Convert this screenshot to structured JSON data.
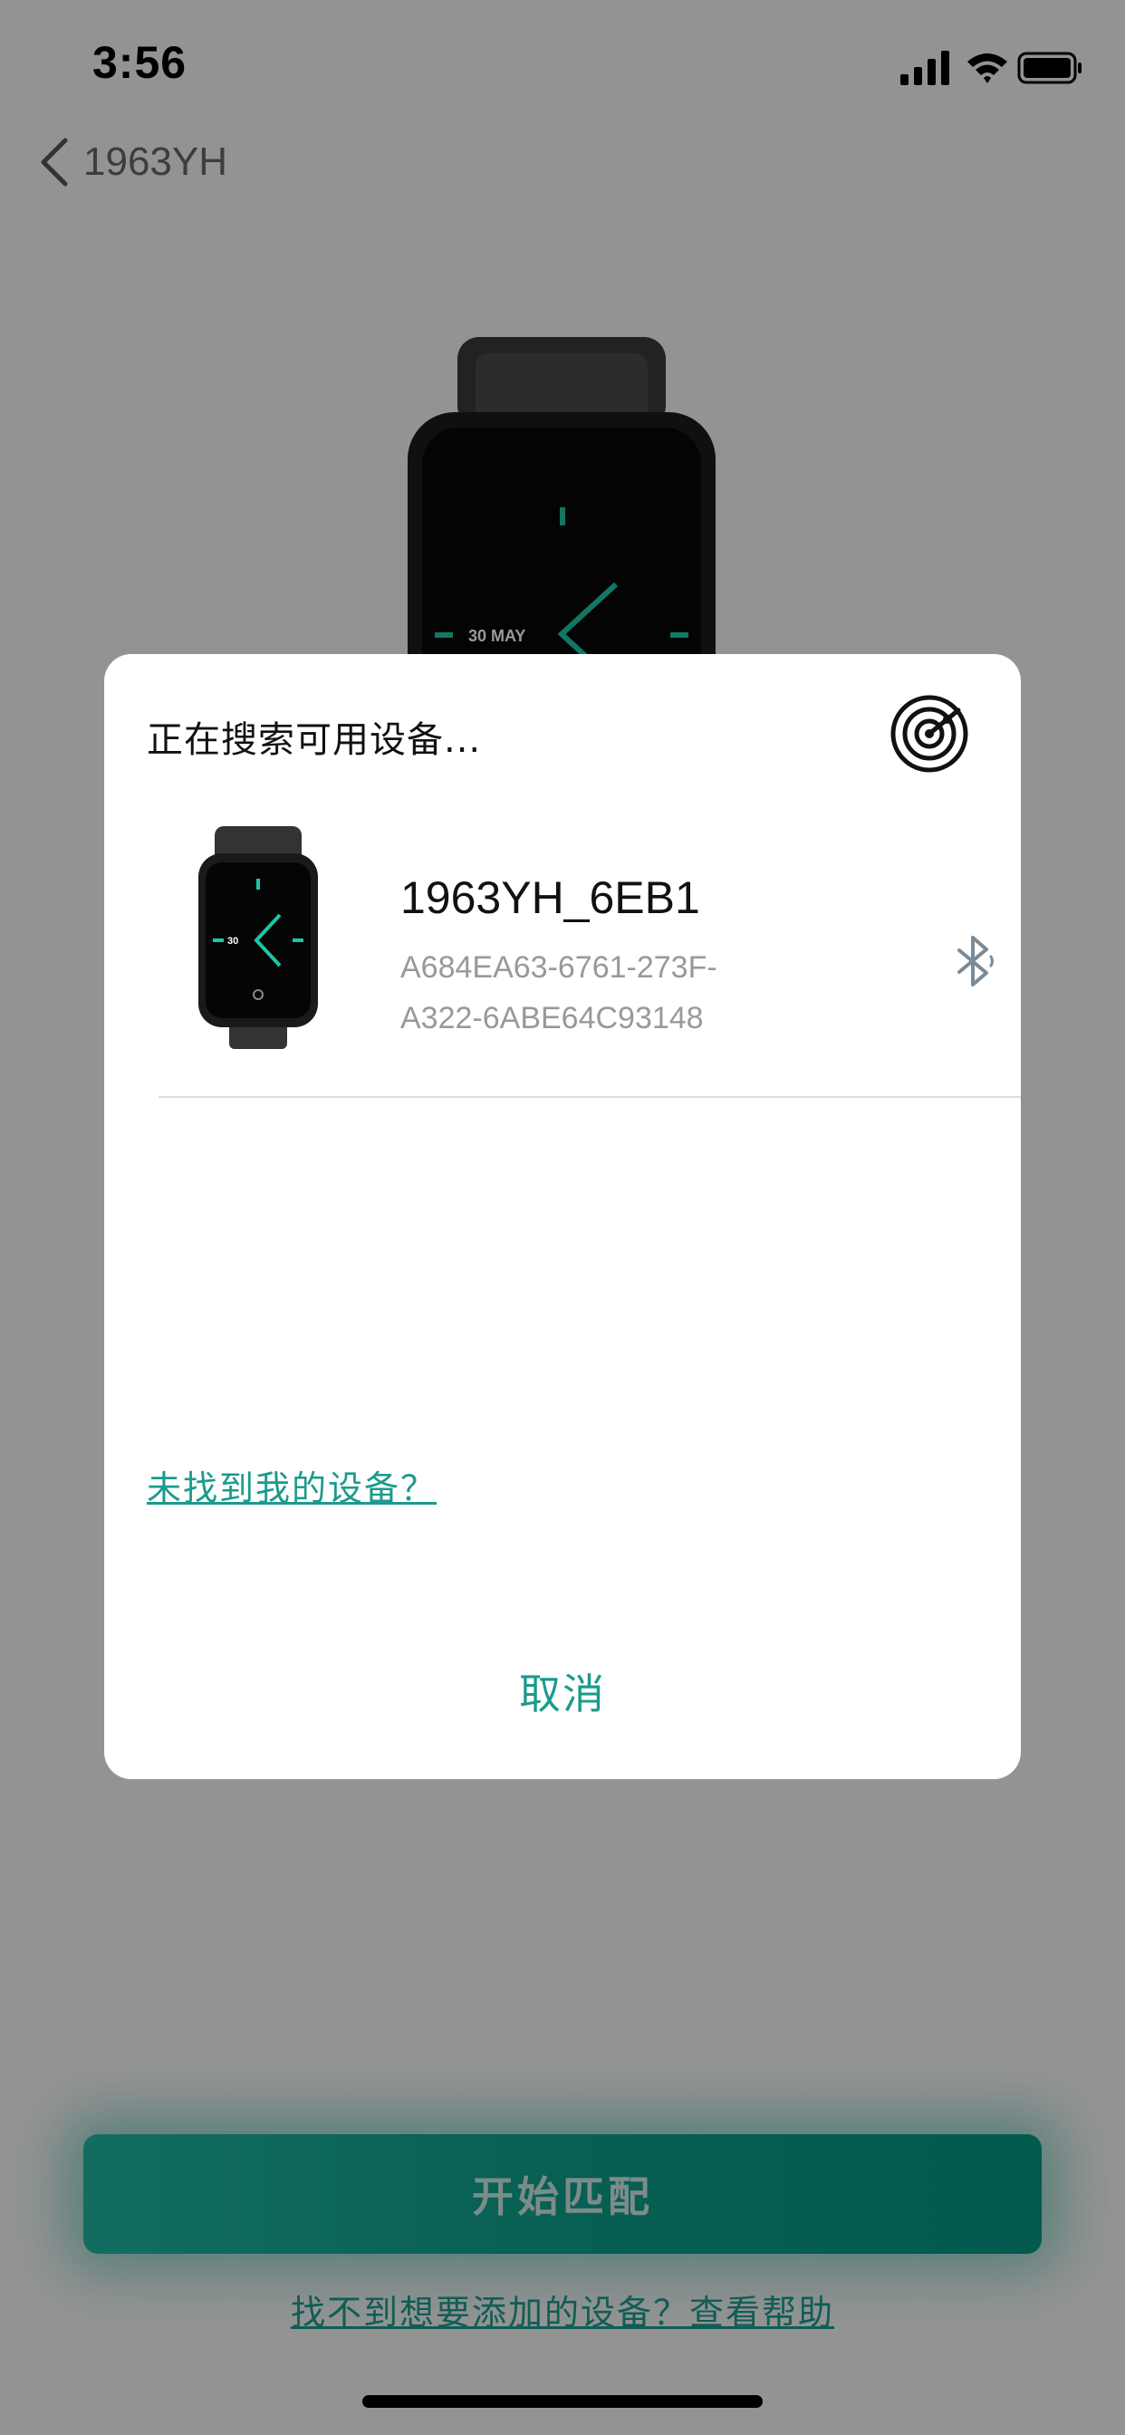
{
  "status_bar": {
    "time": "3:56"
  },
  "nav": {
    "title": "1963YH"
  },
  "hero": {
    "watch_face_date": "30 MAY"
  },
  "dialog": {
    "title": "正在搜索可用设备...",
    "devices": [
      {
        "name": "1963YH_6EB1",
        "id_line1": "A684EA63-6761-273F-",
        "id_line2": "A322-6ABE64C93148",
        "icon": "bluetooth-icon",
        "thumb_date": "30"
      }
    ],
    "not_found_link": "未找到我的设备？",
    "cancel_label": "取消"
  },
  "bottom": {
    "primary_button": "开始匹配",
    "help_link": "找不到想要添加的设备？查看帮助"
  },
  "colors": {
    "accent": "#1b9b8c",
    "button_gradient_start": "#20b5a1",
    "button_gradient_end": "#049684",
    "overlay": "rgba(0,0,0,0.4)"
  },
  "icons": [
    "back-chevron-icon",
    "signal-icon",
    "wifi-icon",
    "battery-icon",
    "radar-icon",
    "bluetooth-icon"
  ]
}
